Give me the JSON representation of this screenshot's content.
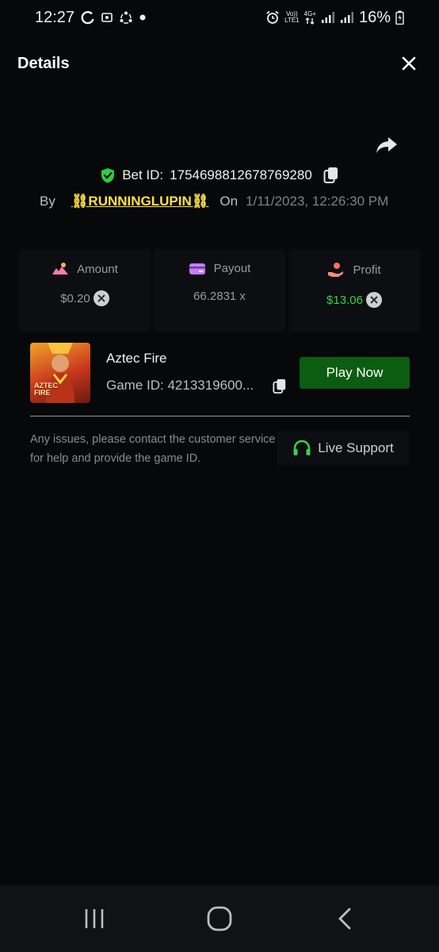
{
  "status_bar": {
    "time": "12:27",
    "sim_label_top": "Vo))",
    "sim_label_bottom": "LTE1",
    "network_top": "4G+",
    "battery": "16%"
  },
  "header": {
    "title": "Details"
  },
  "bet": {
    "label": "Bet ID:",
    "id": "1754698812678769280",
    "by_label": "By",
    "username": "⛓RUNNINGLUPIN⛓",
    "on_label": "On",
    "date": "1/11/2023, 12:26:30 PM"
  },
  "stats": {
    "amount_label": "Amount",
    "amount_value": "$0.20",
    "payout_label": "Payout",
    "payout_value": "66.2831 x",
    "profit_label": "Profit",
    "profit_value": "$13.06"
  },
  "game": {
    "name": "Aztec Fire",
    "id_text": "Game ID: 4213319600...",
    "thumb_line1": "AZTEC",
    "thumb_line2": "FIRE",
    "play_label": "Play Now"
  },
  "support": {
    "help_text": "Any issues, please contact the customer service for help and provide the game ID.",
    "button_label": "Live Support"
  },
  "colors": {
    "background": "#07080a",
    "play_button": "#0c5d12",
    "profit_green": "#35d44a",
    "username_yellow": "#ffe04a",
    "shield_green": "#2ecc40"
  }
}
